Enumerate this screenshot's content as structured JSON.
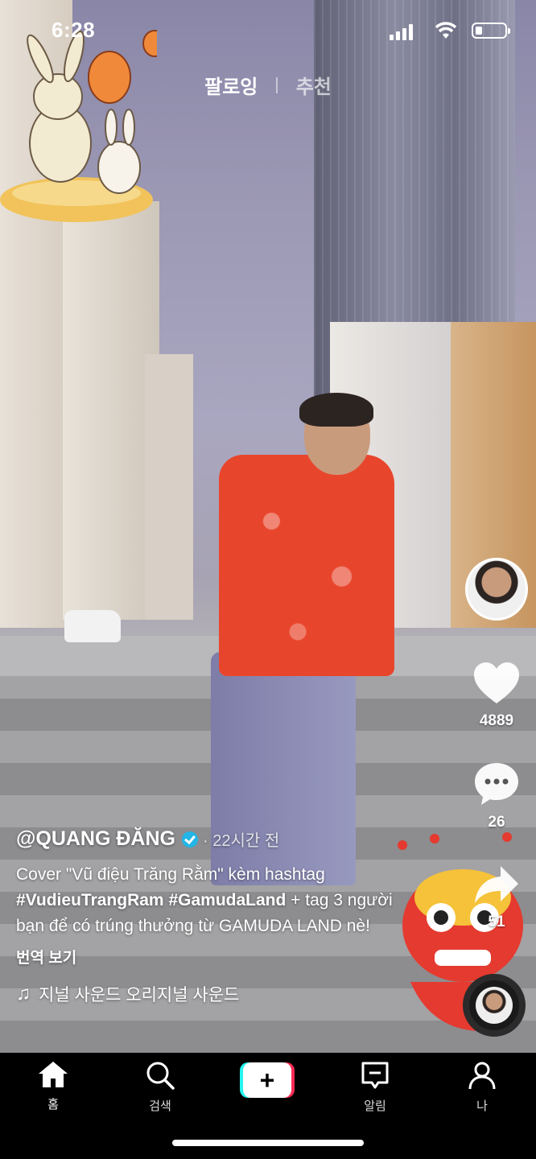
{
  "status_bar": {
    "time": "6:28"
  },
  "top_tabs": {
    "following": "팔로잉",
    "for_you": "추천"
  },
  "rail": {
    "likes": "4889",
    "comments": "26",
    "shares": "51"
  },
  "post": {
    "username": "@QUANG ĐĂNG",
    "posted": "· 22시간 전",
    "desc_prefix": "Cover \"Vũ điệu Trăng Rằm\" kèm hashtag",
    "hashtag1": "#VudieuTrangRam",
    "hashtag2": "#GamudaLand",
    "desc_suffix": " + tag 3 người bạn để có trúng thưởng từ GAMUDA LAND nè!",
    "translate": "번역 보기",
    "sound": "지널 사운드   오리지널 사운드"
  },
  "nav": {
    "home": "홈",
    "search": "검색",
    "inbox": "알림",
    "profile": "나"
  },
  "colors": {
    "accent_cyan": "#25f4ee",
    "accent_red": "#fe2c55",
    "verified": "#22b5e6"
  }
}
